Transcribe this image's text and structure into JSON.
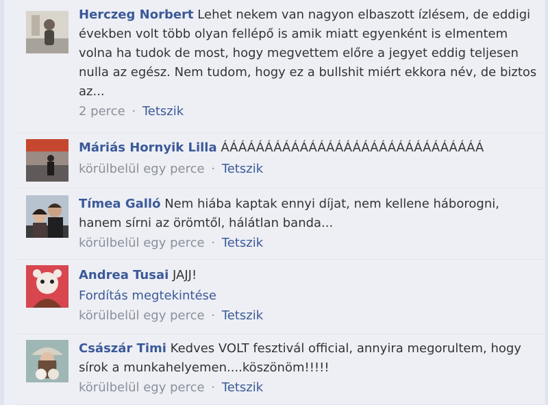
{
  "comments": [
    {
      "author": "Herczeg Norbert",
      "text": "Lehet nekem van nagyon elbaszott ízlésem, de eddigi években volt több olyan fellépő is amik miatt egyenként is elmentem volna ha tudok de most, hogy megvettem előre a jegyet eddig teljesen nulla az egész. Nem tudom, hogy ez a bullshit miért ekkora név, de biztos az...",
      "time": "2 perce",
      "like": "Tetszik"
    },
    {
      "author": "Máriás Hornyik Lilla",
      "text": "ÁÁÁÁÁÁÁÁÁÁÁÁÁÁÁÁÁÁÁÁÁÁÁÁÁÁÁÁÁÁ",
      "time": "körülbelül egy perce",
      "like": "Tetszik"
    },
    {
      "author": "Tímea Galló",
      "text": "Nem hiába kaptak ennyi díjat, nem kellene háborogni, hanem sírni az örömtől, hálátlan banda...",
      "time": "körülbelül egy perce",
      "like": "Tetszik"
    },
    {
      "author": "Andrea Tusai",
      "text": "JAJJ!",
      "translate": "Fordítás megtekintése",
      "time": "körülbelül egy perce",
      "like": "Tetszik"
    },
    {
      "author": "Császár Timi",
      "text": "Kedves VOLT fesztivál official, annyira megorultem, hogy sírok a munkahelyemen....köszönöm!!!!!",
      "time": "körülbelül egy perce",
      "like": "Tetszik"
    }
  ],
  "separator": "·",
  "colors": {
    "link": "#3b5998",
    "meta": "#8a8f9a",
    "background": "#edeff4"
  }
}
